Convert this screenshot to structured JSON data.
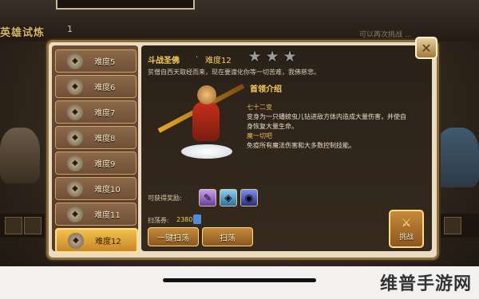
{
  "background": {
    "mode_title": "英雄试炼",
    "mode_number": "1",
    "right_text": "可以再次挑战 ..."
  },
  "levels": [
    {
      "label": "难度5",
      "icon": "level-emblem",
      "selected": false
    },
    {
      "label": "难度6",
      "icon": "level-emblem",
      "selected": false
    },
    {
      "label": "难度7",
      "icon": "level-emblem",
      "selected": false
    },
    {
      "label": "难度8",
      "icon": "level-emblem",
      "selected": false
    },
    {
      "label": "难度9",
      "icon": "level-emblem",
      "selected": false
    },
    {
      "label": "难度10",
      "icon": "level-emblem",
      "selected": false
    },
    {
      "label": "难度11",
      "icon": "level-emblem",
      "selected": false
    },
    {
      "label": "难度12",
      "icon": "level-emblem",
      "selected": true
    }
  ],
  "stage": {
    "title": "斗战圣佛",
    "dot": "·",
    "level": "难度12",
    "stars_filled": 0,
    "stars_total": 3,
    "description": "贫僧自西天取经而来，现在要渡化你等一切苦难，我佛慈悲。"
  },
  "info": {
    "title": "首领介绍",
    "skill1_name": "七十二变",
    "skill1_desc_1": "变身为一只蟠螃虫儿钻进敌方体内造成大量伤害，并使自",
    "skill1_desc_2": "身恢复大量生命。",
    "skill2_name": "魔一切吧",
    "skill2_desc": "免疫所有魔法伤害和大多数控制技能。"
  },
  "rewards": {
    "label": "可获得奖励:",
    "items": [
      "reward-scroll-icon",
      "reward-gem-icon",
      "reward-orb-icon"
    ]
  },
  "sweep": {
    "label": "扫荡券:",
    "count": "2380",
    "one_click_label": "一键扫荡",
    "sweep_label": "扫荡"
  },
  "challenge": {
    "label": "挑战"
  },
  "close_label": "✕",
  "watermark": "维普手游网",
  "colors": {
    "accent_gold": "#f6cf5b",
    "panel_bg": "#e9dcc0",
    "selected_item": "#f0c14b"
  }
}
